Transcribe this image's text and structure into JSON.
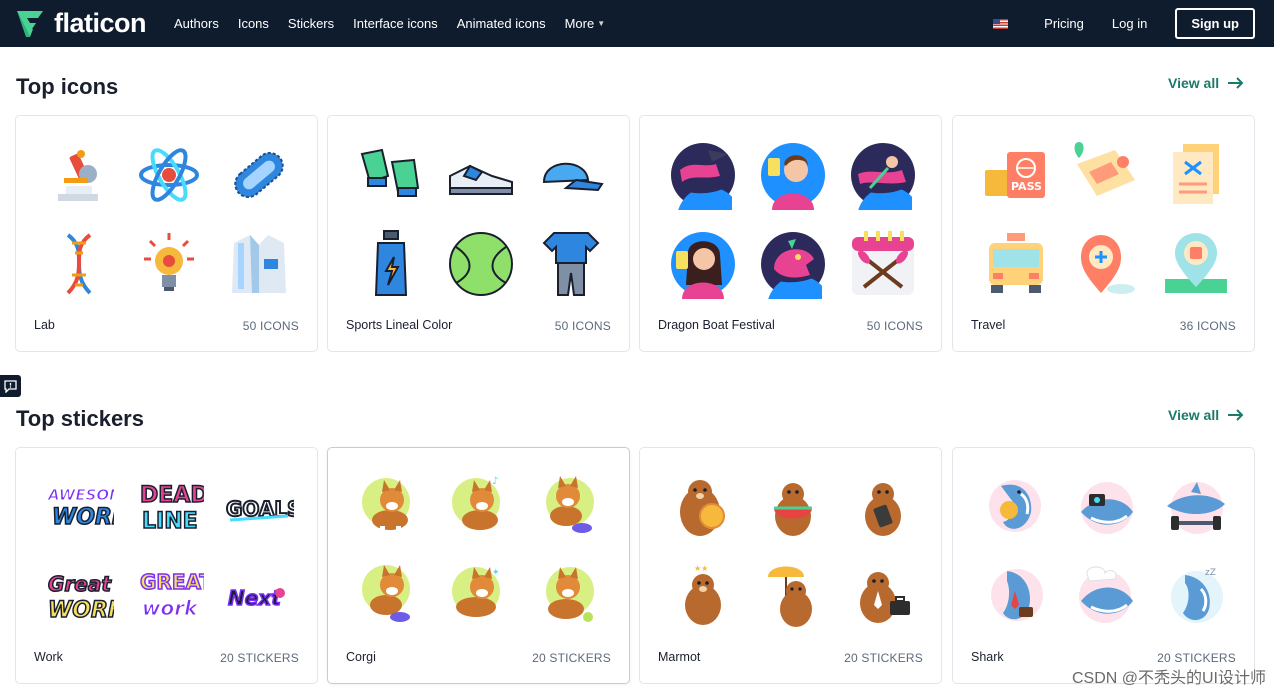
{
  "brand": {
    "name": "flaticon",
    "accent": "#4ad295",
    "nav_bg": "#0f1c2e"
  },
  "nav": {
    "links": [
      {
        "label": "Authors"
      },
      {
        "label": "Icons"
      },
      {
        "label": "Stickers"
      },
      {
        "label": "Interface icons"
      },
      {
        "label": "Animated icons"
      },
      {
        "label": "More"
      }
    ],
    "flag_icon": "us-flag-icon",
    "pricing": "Pricing",
    "login": "Log in",
    "signup": "Sign up"
  },
  "top_icons": {
    "title": "Top icons",
    "view_all": "View all",
    "packs": [
      {
        "name": "Lab",
        "count": "50 ICONS",
        "icons": [
          "microscope-icon",
          "atom-icon",
          "bacteria-icon",
          "dna-icon",
          "idea-bulb-icon",
          "lab-coat-icon"
        ]
      },
      {
        "name": "Sports Lineal Color",
        "count": "50 ICONS",
        "icons": [
          "gloves-icon",
          "sneaker-icon",
          "cap-icon",
          "water-bottle-icon",
          "tennis-ball-icon",
          "jersey-icon"
        ]
      },
      {
        "name": "Dragon Boat Festival",
        "count": "50 ICONS",
        "icons": [
          "dragon-boat-icon",
          "man-drink-icon",
          "boat-rower-icon",
          "woman-drink-icon",
          "dragon-head-icon",
          "paddles-calendar-icon"
        ]
      },
      {
        "name": "Travel",
        "count": "36 ICONS",
        "icons": [
          "passport-icon",
          "map-icon",
          "documents-icon",
          "van-icon",
          "location-pin-icon",
          "map-marker-icon"
        ]
      }
    ]
  },
  "top_stickers": {
    "title": "Top stickers",
    "view_all": "View all",
    "packs": [
      {
        "name": "Work",
        "count": "20 STICKERS",
        "icons": [
          "awesome-work-sticker",
          "dead-line-sticker",
          "goals-sticker",
          "great-work-sticker",
          "great-work-2-sticker",
          "next-sticker"
        ]
      },
      {
        "name": "Corgi",
        "count": "20 STICKERS",
        "icons": [
          "corgi-sticker",
          "corgi-music-sticker",
          "corgi-bowl-sticker",
          "corgi-bowl-2-sticker",
          "corgi-sitting-sticker",
          "corgi-ball-sticker"
        ]
      },
      {
        "name": "Marmot",
        "count": "20 STICKERS",
        "icons": [
          "marmot-coin-sticker",
          "marmot-watermelon-sticker",
          "marmot-phone-sticker",
          "marmot-crown-sticker",
          "marmot-umbrella-sticker",
          "marmot-briefcase-sticker"
        ]
      },
      {
        "name": "Shark",
        "count": "20 STICKERS",
        "icons": [
          "shark-coin-sticker",
          "shark-camera-sticker",
          "shark-dumbbell-sticker",
          "shark-tie-sticker",
          "shark-chef-sticker",
          "shark-sleep-sticker"
        ]
      }
    ]
  },
  "watermark": "CSDN @不秃头的UI设计师"
}
